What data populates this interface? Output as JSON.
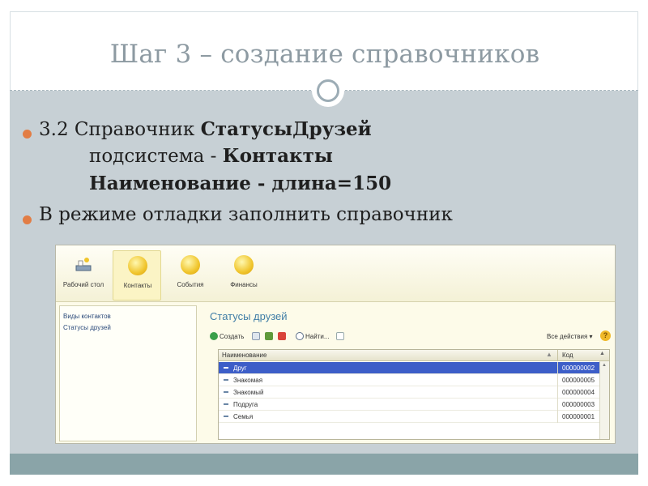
{
  "slide": {
    "title": "Шаг 3 – создание справочников",
    "bullets": [
      {
        "prefix": "3.2 Справочник ",
        "bold": "СтатусыДрузей",
        "line2_prefix": "подсистема - ",
        "line2_bold": "Контакты",
        "line3_bold": "Наименование  - длина=150"
      },
      {
        "text": "В режиме отладки заполнить  справочник"
      }
    ],
    "colors": {
      "bullet": "#e27d45",
      "body_bg": "#c7d0d5",
      "bottom_bar": "#8aa4a8",
      "title": "#8d9aa2"
    }
  },
  "app": {
    "toolbar": [
      {
        "label": "Рабочий стол",
        "icon": "desktop-icon"
      },
      {
        "label": "Контакты",
        "icon": "circle-icon"
      },
      {
        "label": "События",
        "icon": "circle-icon"
      },
      {
        "label": "Финансы",
        "icon": "circle-icon"
      }
    ],
    "nav": [
      "Виды контактов",
      "Статусы друзей"
    ],
    "form_title": "Статусы друзей",
    "commands": {
      "create": "Создать",
      "find": "Найти...",
      "all_actions": "Все действия ▾",
      "help": "?"
    },
    "table": {
      "headers": [
        "Наименование",
        "Код"
      ],
      "rows": [
        {
          "name": "Друг",
          "code": "000000002",
          "selected": true
        },
        {
          "name": "Знакомая",
          "code": "000000005"
        },
        {
          "name": "Знакомый",
          "code": "000000004"
        },
        {
          "name": "Подруга",
          "code": "000000003"
        },
        {
          "name": "Семья",
          "code": "000000001"
        }
      ]
    }
  }
}
